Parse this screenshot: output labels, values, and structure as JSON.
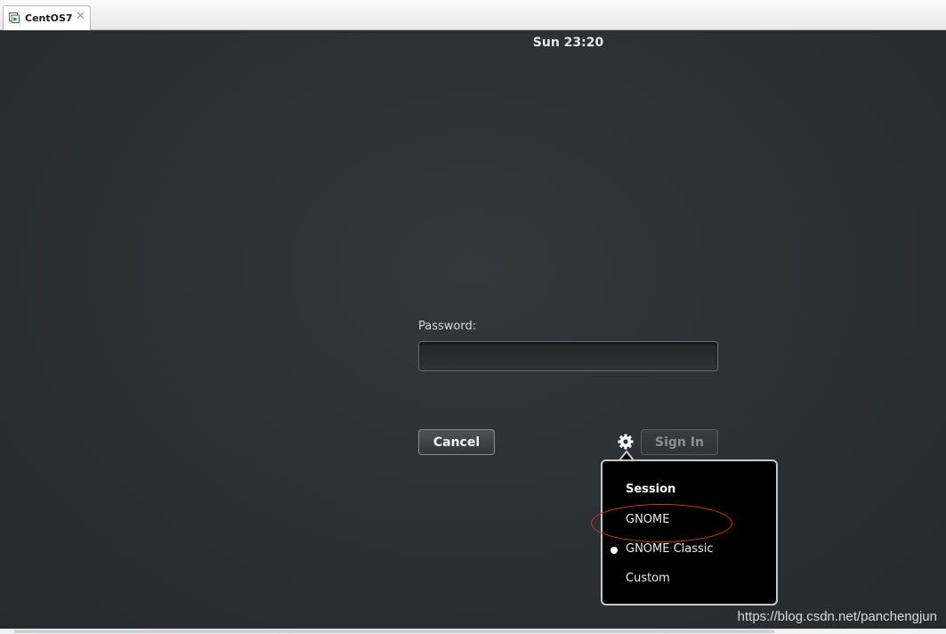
{
  "tab": {
    "title": "CentOS7",
    "close_glyph": "✕",
    "icon": "vm-icon"
  },
  "clock": "Sun 23:20",
  "login": {
    "password_label": "Password:",
    "password_value": "",
    "cancel_label": "Cancel",
    "signin_label": "Sign In",
    "settings_icon": "gear-icon"
  },
  "session_menu": {
    "header": "Session",
    "items": [
      {
        "label": "GNOME",
        "selected": false
      },
      {
        "label": "GNOME Classic",
        "selected": true
      },
      {
        "label": "Custom",
        "selected": false
      }
    ]
  },
  "watermark": "https://blog.csdn.net/panchengjun",
  "colors": {
    "background": "#2d3033",
    "popover": "#000000",
    "annotation": "#d0342c"
  }
}
